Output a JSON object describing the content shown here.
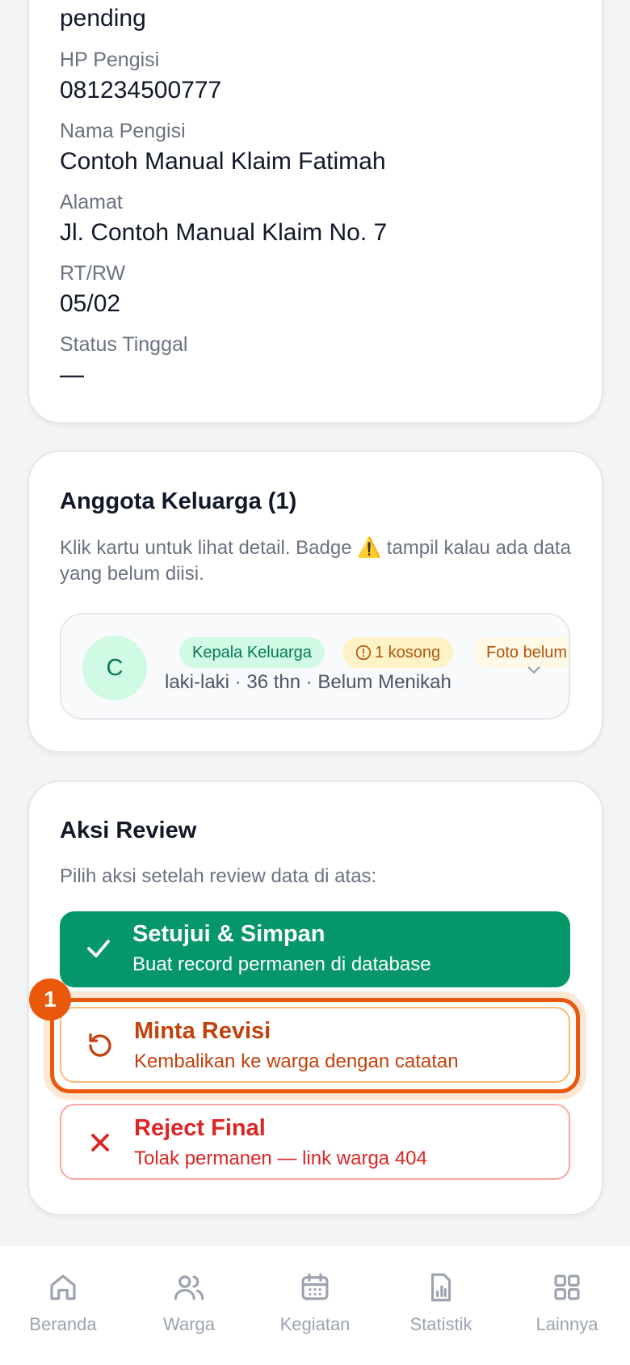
{
  "household": {
    "status_value": "pending",
    "fields": [
      {
        "label": "HP Pengisi",
        "value": "081234500777"
      },
      {
        "label": "Nama Pengisi",
        "value": "Contoh Manual Klaim Fatimah"
      },
      {
        "label": "Alamat",
        "value": "Jl. Contoh Manual Klaim No. 7"
      },
      {
        "label": "RT/RW",
        "value": "05/02"
      },
      {
        "label": "Status Tinggal",
        "value": "—"
      }
    ]
  },
  "family": {
    "title": "Anggota Keluarga (1)",
    "description_before": "Klik kartu untuk lihat detail. Badge",
    "warning_glyph": "⚠️",
    "description_after": " tampil kalau ada data yang belum diisi.",
    "member": {
      "initial": "C",
      "badge_head": "Kepala Keluarga",
      "badge_empty": "1 kosong",
      "badge_photo": "Foto belum",
      "info": "laki-laki · 36 thn · Belum Menikah"
    }
  },
  "review": {
    "title": "Aksi Review",
    "description": "Pilih aksi setelah review data di atas:",
    "step_number": "1",
    "actions": {
      "approve": {
        "title": "Setujui & Simpan",
        "subtitle": "Buat record permanen di database",
        "icon": "check-icon"
      },
      "revise": {
        "title": "Minta Revisi",
        "subtitle": "Kembalikan ke warga dengan catatan",
        "icon": "undo-icon"
      },
      "reject": {
        "title": "Reject Final",
        "subtitle": "Tolak permanen — link warga 404",
        "icon": "x-icon"
      }
    }
  },
  "nav": {
    "items": [
      {
        "label": "Beranda",
        "icon": "home-icon"
      },
      {
        "label": "Warga",
        "icon": "users-icon"
      },
      {
        "label": "Kegiatan",
        "icon": "calendar-icon"
      },
      {
        "label": "Statistik",
        "icon": "chart-file-icon"
      },
      {
        "label": "Lainnya",
        "icon": "grid-icon"
      }
    ]
  },
  "colors": {
    "approve": "#059669",
    "revise": "#ea580c",
    "reject": "#dc2626",
    "nav_inactive": "#9ca3af"
  }
}
